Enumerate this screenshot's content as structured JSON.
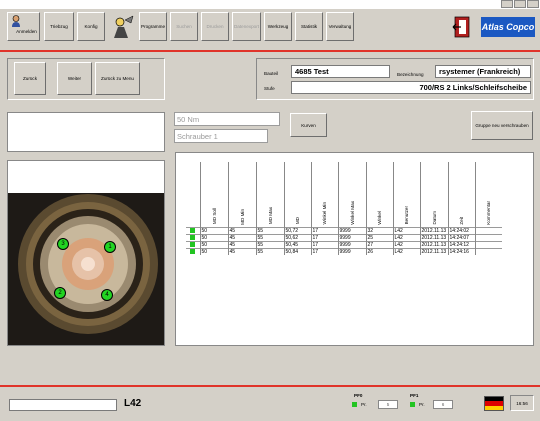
{
  "toolbar": {
    "items": [
      {
        "label": "Anmelden",
        "enabled": true
      },
      {
        "label": "Triebzug",
        "enabled": true
      },
      {
        "label": "Konfig",
        "enabled": true
      },
      {
        "label": "Programme",
        "enabled": true
      },
      {
        "label": "Suchen",
        "enabled": false
      },
      {
        "label": "Drucken",
        "enabled": false
      },
      {
        "label": "Datenexport",
        "enabled": false
      },
      {
        "label": "Werkzeug",
        "enabled": true
      },
      {
        "label": "Statistik",
        "enabled": true
      },
      {
        "label": "Verwaltung",
        "enabled": true
      }
    ],
    "logo": "Atlas Copco"
  },
  "nav": {
    "back": "Zurück",
    "next": "Weiter",
    "menu": "Zurück zu Menu"
  },
  "part": {
    "bauteil_label": "Bauteil",
    "bauteil_value": "4685 Test",
    "bezeichnung_label": "Bezeichnung",
    "bezeichnung_value": "rsystemer (Frankreich)",
    "stufe_label": "Stufe",
    "stufe_value": "700/RS 2 Links/Schleifscheibe"
  },
  "controls": {
    "torque": "50 Nm",
    "screwer": "Schrauber 1",
    "curves_button": "Kurven",
    "group_button": "Gruppe neu verschrauben"
  },
  "table": {
    "columns": [
      "MD Soll",
      "MD Min",
      "MD Max",
      "MD",
      "Winkel Min",
      "Winkel Max",
      "Winkel",
      "Benutzer",
      "Datum",
      "Zeit",
      "Kommentar"
    ],
    "rows": [
      {
        "status": "ok",
        "cells": [
          "50",
          "45",
          "55",
          "50,72",
          "17",
          "9999",
          "32",
          "L42",
          "2012.11.13",
          "14:24:02",
          ""
        ]
      },
      {
        "status": "ok",
        "cells": [
          "50",
          "45",
          "55",
          "50,62",
          "17",
          "9999",
          "25",
          "L42",
          "2012.11.13",
          "14:24:07",
          ""
        ]
      },
      {
        "status": "ok",
        "cells": [
          "50",
          "45",
          "55",
          "50,45",
          "17",
          "9999",
          "27",
          "L42",
          "2012.11.13",
          "14:24:12",
          ""
        ]
      },
      {
        "status": "ok",
        "cells": [
          "50",
          "45",
          "55",
          "50,84",
          "17",
          "9999",
          "26",
          "L42",
          "2012.11.13",
          "14:24:16",
          ""
        ]
      }
    ]
  },
  "image": {
    "bolts": [
      "3",
      "1",
      "2",
      "4"
    ]
  },
  "status": {
    "left_input": "",
    "user": "L42",
    "pf0_label": "PF0",
    "pf0_pr": "Pr.",
    "pf0_value": "5",
    "pf1_label": "PF1",
    "pf1_pr": "Pr.",
    "pf1_value": "6",
    "time": "16:56"
  }
}
